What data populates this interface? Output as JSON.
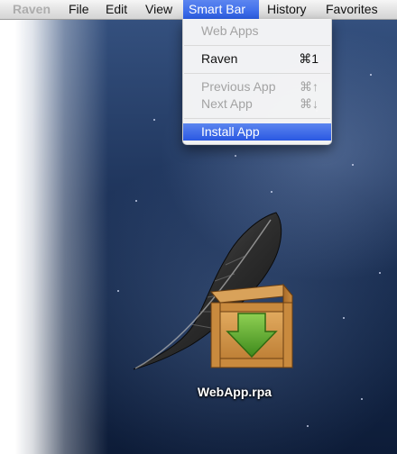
{
  "menubar": {
    "app_name": "Raven",
    "items": [
      "File",
      "Edit",
      "View",
      "Smart Bar",
      "History",
      "Favorites"
    ],
    "active": "Smart Bar"
  },
  "dropdown": {
    "items": [
      {
        "label": "Web Apps",
        "shortcut": "",
        "state": "disabled"
      },
      {
        "label": "Raven",
        "shortcut": "⌘1",
        "state": "enabled"
      },
      {
        "label": "Previous App",
        "shortcut": "⌘↑",
        "state": "disabled"
      },
      {
        "label": "Next App",
        "shortcut": "⌘↓",
        "state": "disabled"
      },
      {
        "label": "Install App",
        "shortcut": "",
        "state": "highlighted"
      }
    ]
  },
  "desktop": {
    "file_name": "WebApp.rpa",
    "file_icon": "feather-package-icon"
  },
  "colors": {
    "highlight": "#2c5ee6",
    "package_wood": "#c98a3e",
    "download_arrow": "#5fa32a"
  }
}
